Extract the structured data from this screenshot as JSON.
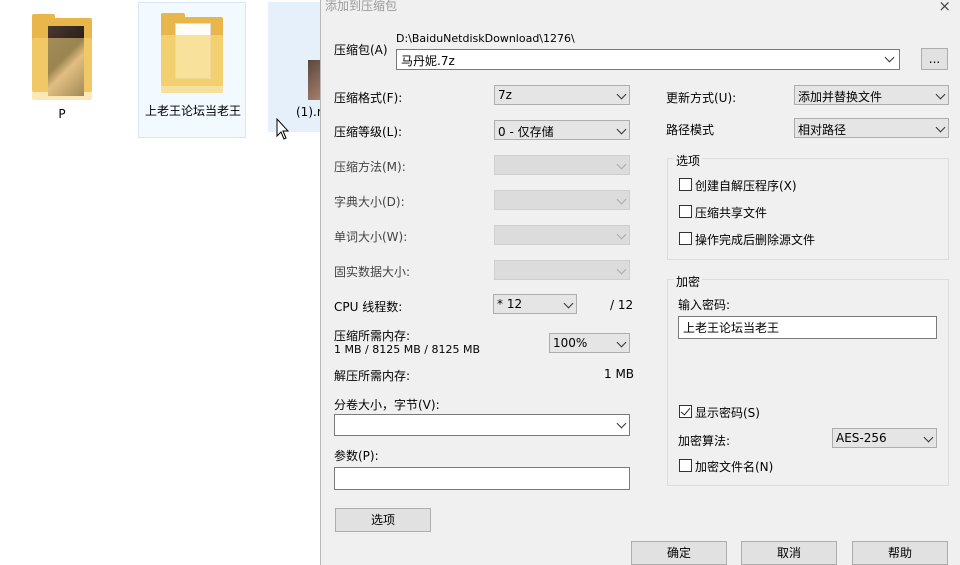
{
  "desktop": {
    "items": [
      {
        "label": "P"
      },
      {
        "label": "上老王论坛当老王"
      },
      {
        "label": "(1).r"
      }
    ]
  },
  "dialog": {
    "title": "添加到压缩包",
    "close_glyph": "×",
    "archive_label": "压缩包(A)",
    "archive_path": "D:\\BaiduNetdiskDownload\\1276\\",
    "archive_name": "马丹妮.7z",
    "browse_label": "...",
    "format_label": "压缩格式(F):",
    "format_value": "7z",
    "level_label": "压缩等级(L):",
    "level_value": "0 - 仅存储",
    "method_label": "压缩方法(M):",
    "dict_label": "字典大小(D):",
    "word_label": "单词大小(W):",
    "solid_label": "固实数据大小:",
    "cpu_label": "CPU 线程数:",
    "cpu_value": "* 12",
    "cpu_total": "/ 12",
    "mem_comp_label": "压缩所需内存:",
    "mem_comp_value": "1 MB / 8125 MB / 8125 MB",
    "mem_percent": "100%",
    "mem_decomp_label": "解压所需内存:",
    "mem_decomp_value": "1 MB",
    "split_label": "分卷大小，字节(V):",
    "split_value": "",
    "params_label": "参数(P):",
    "params_value": "",
    "options_button": "选项",
    "update_label": "更新方式(U):",
    "update_value": "添加并替换文件",
    "path_label": "路径模式",
    "path_value": "相对路径",
    "options_group": {
      "title": "选项",
      "sfx": {
        "label": "创建自解压程序(X)",
        "checked": false
      },
      "shared": {
        "label": "压缩共享文件",
        "checked": false
      },
      "delete": {
        "label": "操作完成后删除源文件",
        "checked": false
      }
    },
    "encrypt_group": {
      "title": "加密",
      "password_label": "输入密码:",
      "password_value": "上老王论坛当老王",
      "show_password": {
        "label": "显示密码(S)",
        "checked": true
      },
      "algo_label": "加密算法:",
      "algo_value": "AES-256",
      "encrypt_names": {
        "label": "加密文件名(N)",
        "checked": false
      }
    },
    "ok_button": "确定",
    "cancel_button": "取消",
    "help_button": "帮助"
  }
}
